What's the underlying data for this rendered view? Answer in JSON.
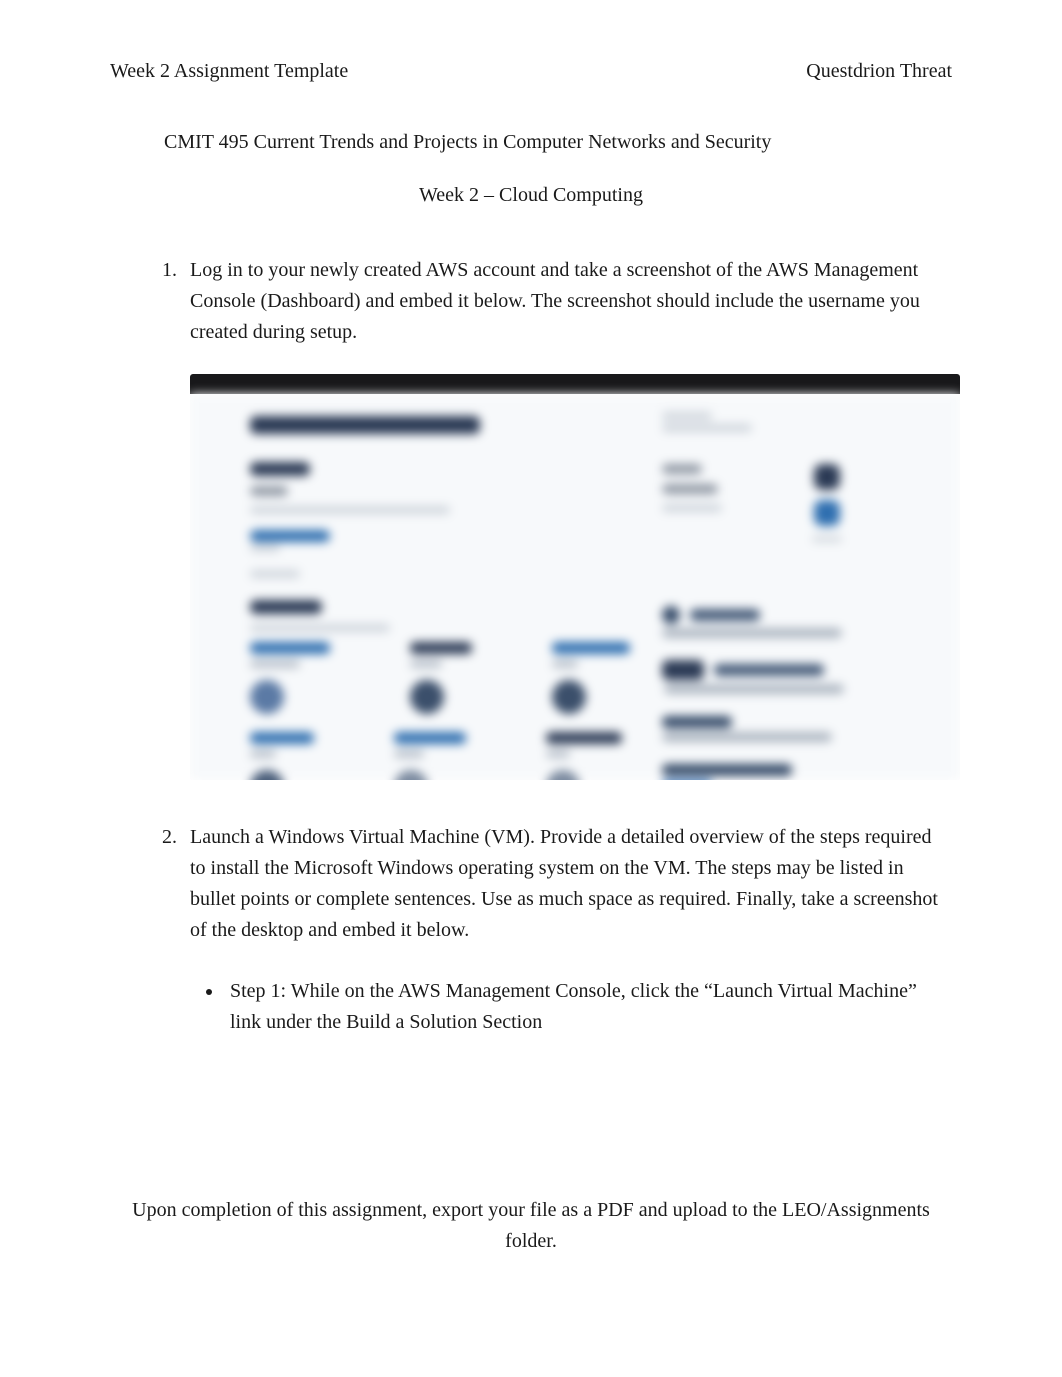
{
  "header": {
    "left": "Week 2 Assignment Template",
    "right": "Questdrion Threat"
  },
  "title": "CMIT 495 Current Trends and Projects in Computer Networks and Security",
  "subtitle": "Week 2  – Cloud Computing",
  "questions": {
    "q1": {
      "text": "Log in to your newly created AWS account and take a screenshot of the AWS Management Console (Dashboard) and embed it below.              The screenshot should include the username you created during setup."
    },
    "q2": {
      "text": "Launch a Windows Virtual Machine (VM).         Provide a detailed overview of the steps required to install the Microsoft Windows operating system on the VM.   The steps may be listed in bullet points or complete sentences. Use as much space as required.         Finally, take a screenshot of the desktop and embed it below.",
      "steps": [
        "Step 1:  While on the AWS Management Console, click the “Launch Virtual Machine” link under the Build a Solution Section"
      ]
    }
  },
  "footer": "Upon completion of this assignment, export your file as a PDF and upload to the LEO/Assignments folder."
}
